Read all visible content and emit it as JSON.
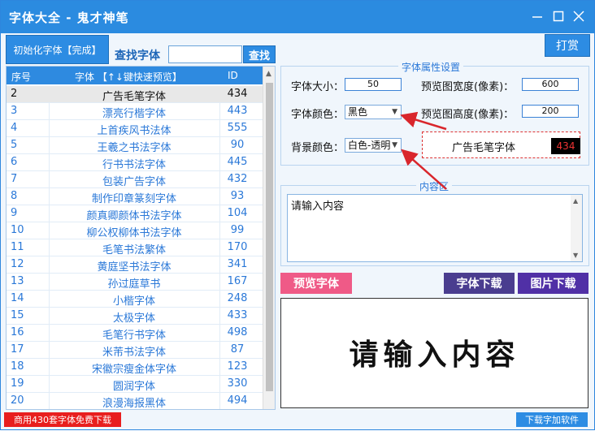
{
  "window": {
    "title": "字体大全 - 鬼才神笔"
  },
  "toolbar": {
    "init_label": "初始化字体【完成】",
    "find_label": "查找字体",
    "find_value": "",
    "find_button": "查找",
    "tip_button": "打赏"
  },
  "list": {
    "headers": {
      "no": "序号",
      "font": "字体 【↑↓键快速预览】",
      "id": "ID"
    },
    "rows": [
      {
        "no": "2",
        "name": "广告毛笔字体",
        "id": "434"
      },
      {
        "no": "3",
        "name": "漂亮行楷字体",
        "id": "443"
      },
      {
        "no": "4",
        "name": "上首疾风书法体",
        "id": "555"
      },
      {
        "no": "5",
        "name": "王羲之书法字体",
        "id": "90"
      },
      {
        "no": "6",
        "name": "行书书法字体",
        "id": "445"
      },
      {
        "no": "7",
        "name": "包装广告字体",
        "id": "432"
      },
      {
        "no": "8",
        "name": "制作印章篆刻字体",
        "id": "93"
      },
      {
        "no": "9",
        "name": "颜真卿颜体书法字体",
        "id": "104"
      },
      {
        "no": "10",
        "name": "柳公权柳体书法字体",
        "id": "99"
      },
      {
        "no": "11",
        "name": "毛笔书法繁体",
        "id": "170"
      },
      {
        "no": "12",
        "name": "黄庭坚书法字体",
        "id": "341"
      },
      {
        "no": "13",
        "name": "孙过庭草书",
        "id": "167"
      },
      {
        "no": "14",
        "name": "小楷字体",
        "id": "248"
      },
      {
        "no": "15",
        "name": "太极字体",
        "id": "433"
      },
      {
        "no": "16",
        "name": "毛笔行书字体",
        "id": "498"
      },
      {
        "no": "17",
        "name": "米芾书法字体",
        "id": "87"
      },
      {
        "no": "18",
        "name": "宋徽宗瘦金体字体",
        "id": "123"
      },
      {
        "no": "19",
        "name": "圆润字体",
        "id": "330"
      },
      {
        "no": "20",
        "name": "浪漫海报黑体",
        "id": "494"
      }
    ]
  },
  "props": {
    "title": "字体属性设置",
    "size_label": "字体大小：",
    "size_value": "50",
    "width_label": "预览图宽度(像素)：",
    "width_value": "600",
    "color_label": "字体颜色：",
    "color_value": "黑色",
    "height_label": "预览图高度(像素)：",
    "height_value": "200",
    "bg_label": "背景颜色：",
    "bg_value": "白色-透明",
    "preview_name": "广告毛笔字体",
    "preview_id": "434"
  },
  "content": {
    "title": "内容区",
    "text": "请输入内容"
  },
  "actions": {
    "preview": "预览字体",
    "download_font": "字体下载",
    "download_image": "图片下载"
  },
  "canvas": {
    "text": "请输入内容"
  },
  "status": {
    "left": "商用430套字体免费下载",
    "right": "下载字加软件"
  },
  "colors": {
    "accent": "#2b8be0",
    "preview_btn": "#ef5a87",
    "download_font": "#4a3d8f",
    "download_image": "#5030a6",
    "arrow": "#d9262c"
  }
}
